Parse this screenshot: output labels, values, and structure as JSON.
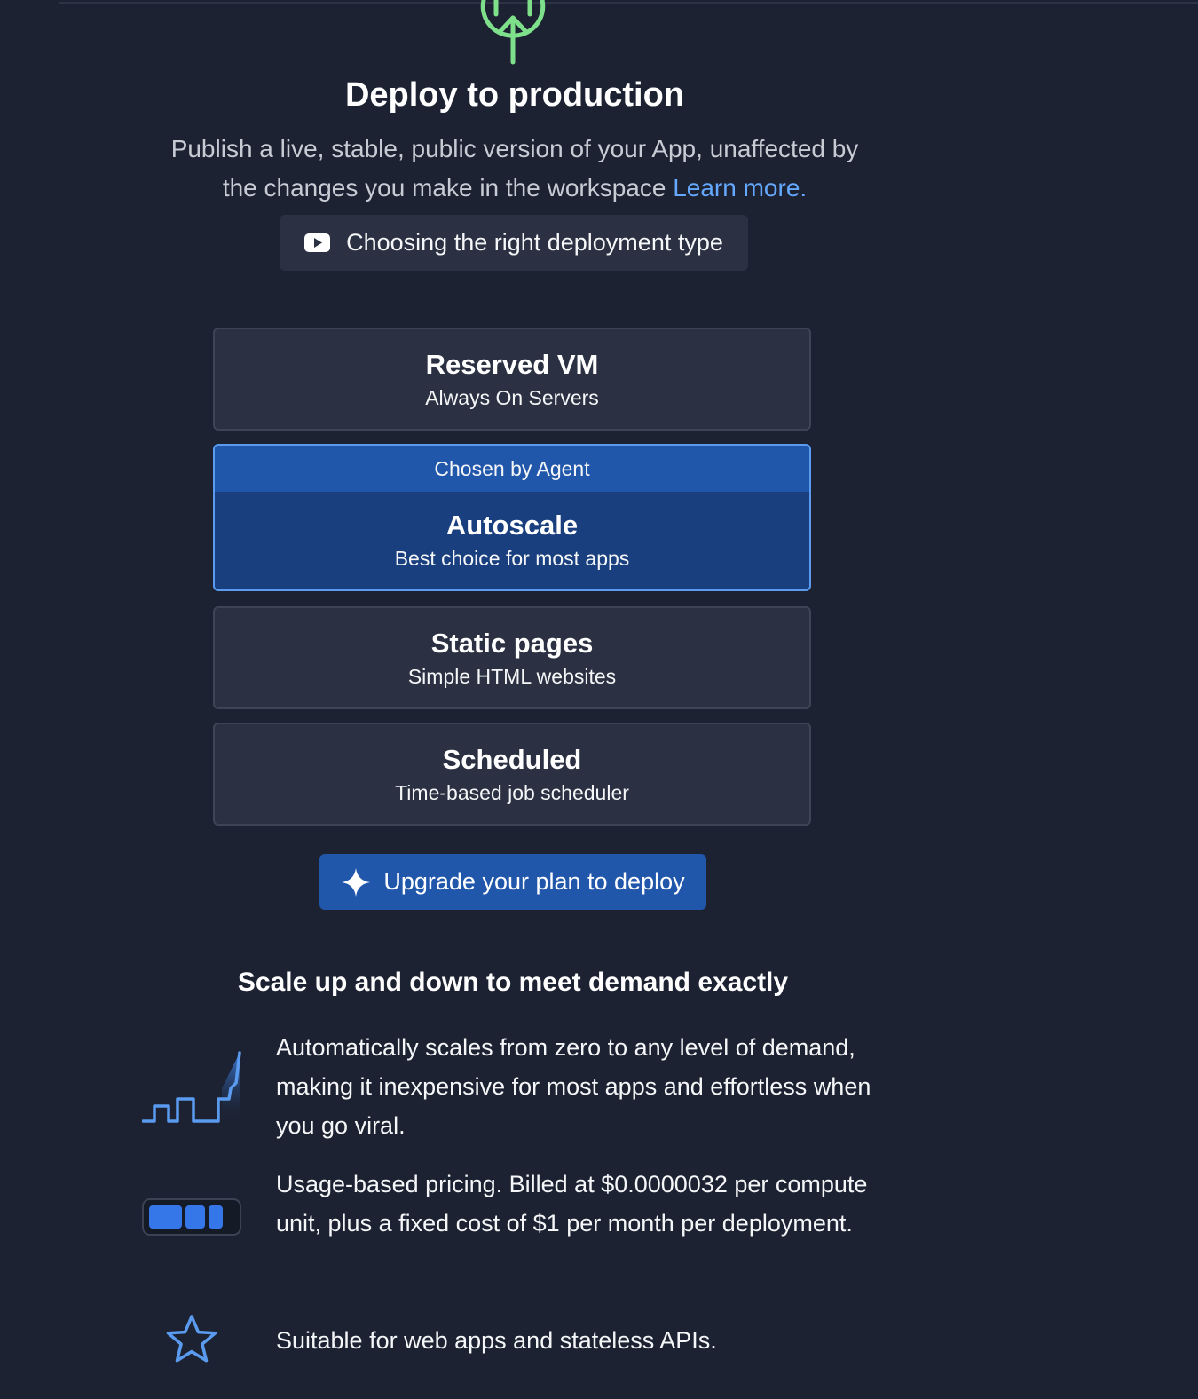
{
  "header": {
    "title": "Deploy to production",
    "description": "Publish a live, stable, public version of your App, unaffected by the changes you make in the workspace",
    "learn_more": "Learn more.",
    "video_button_label": "Choosing the right deployment type",
    "icon": "deploy-upload-icon"
  },
  "options": [
    {
      "title": "Reserved VM",
      "subtitle": "Always On Servers",
      "selected": false
    },
    {
      "title": "Autoscale",
      "subtitle": "Best choice for most apps",
      "selected": true,
      "badge": "Chosen by Agent"
    },
    {
      "title": "Static pages",
      "subtitle": "Simple HTML websites",
      "selected": false
    },
    {
      "title": "Scheduled",
      "subtitle": "Time-based job scheduler",
      "selected": false
    }
  ],
  "upgrade": {
    "label": "Upgrade your plan to deploy",
    "icon": "sparkle-icon"
  },
  "details": {
    "heading": "Scale up and down to meet demand exactly",
    "features": [
      {
        "icon": "scaling-graph-icon",
        "text": "Automatically scales from zero to any level of demand, making it inexpensive for most apps and effortless when you go viral."
      },
      {
        "icon": "battery-icon",
        "text": "Usage-based pricing. Billed at $0.0000032 per compute unit, plus a fixed cost of $1 per month per deployment."
      },
      {
        "icon": "star-icon",
        "text": "Suitable for web apps and stateless APIs."
      }
    ]
  },
  "colors": {
    "background": "#1c2232",
    "card": "#2b3142",
    "selected_card": "#193f7e",
    "selected_banner": "#2157ab",
    "accent_link": "#65a8ff",
    "deploy_icon": "#7ee08a"
  }
}
